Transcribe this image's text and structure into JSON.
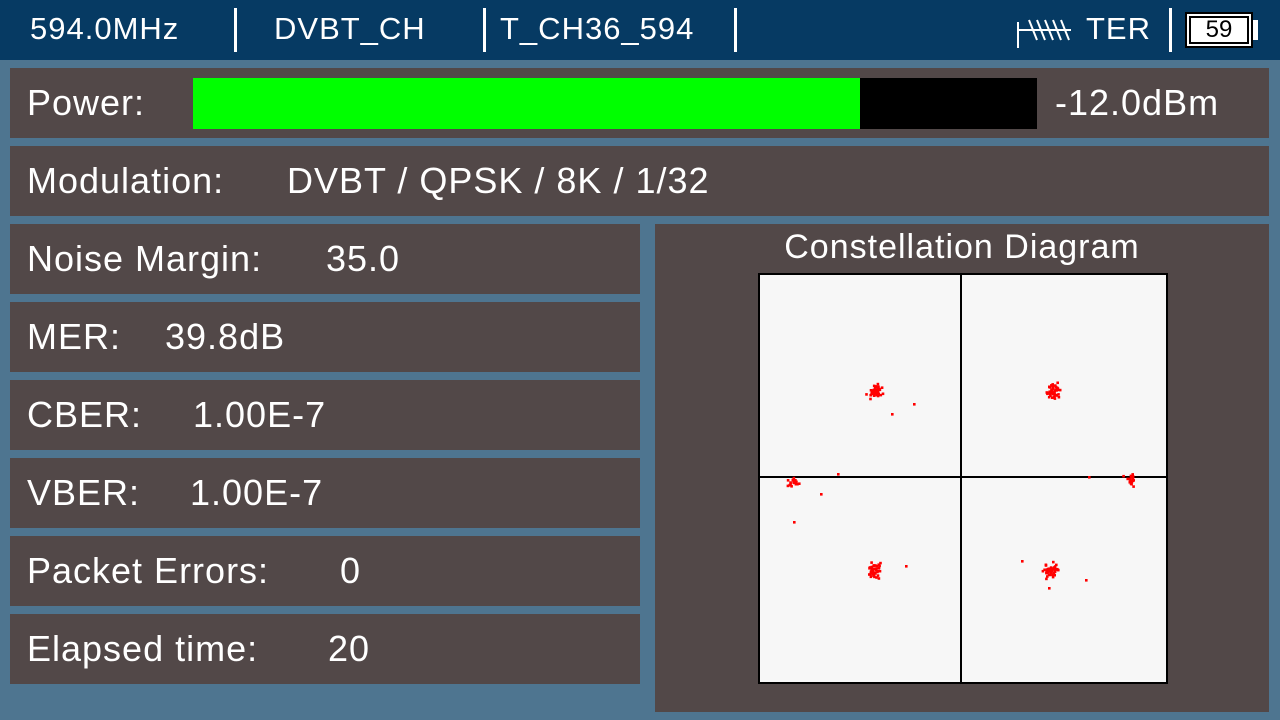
{
  "header": {
    "frequency": "594.0MHz",
    "mode": "DVBT_CH",
    "channel": "T_CH36_594",
    "signal_type": "TER",
    "battery": "59"
  },
  "power": {
    "label": "Power:",
    "value": "-12.0dBm",
    "level_fraction": 0.79,
    "bar_color": "#00ff00"
  },
  "modulation": {
    "label": "Modulation:",
    "value": "DVBT / QPSK / 8K / 1/32"
  },
  "metrics": [
    {
      "label": "Noise Margin:",
      "value": "35.0"
    },
    {
      "label": "MER:",
      "value": "39.8dB"
    },
    {
      "label": "CBER:",
      "value": "1.00E-7"
    },
    {
      "label": "VBER:",
      "value": "1.00E-7"
    },
    {
      "label": "Packet Errors:",
      "value": "0"
    },
    {
      "label": "Elapsed time:",
      "value": "20"
    }
  ],
  "constellation": {
    "title": "Constellation Diagram",
    "dot_color": "#ff0000"
  }
}
